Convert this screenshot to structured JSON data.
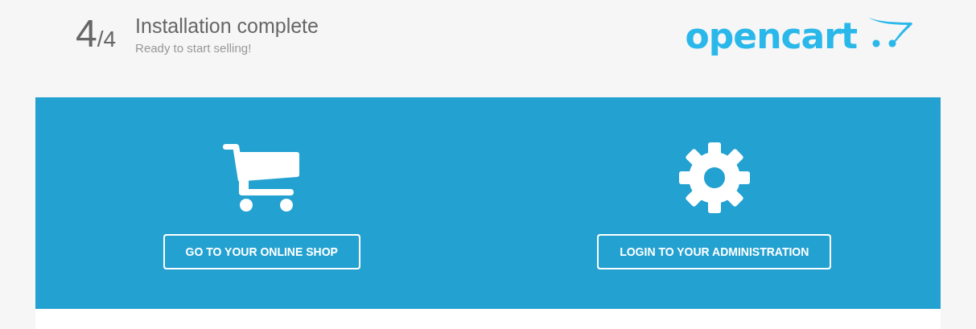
{
  "header": {
    "step_current": "4",
    "step_total": "/4",
    "title": "Installation complete",
    "subtitle": "Ready to start selling!",
    "logo": "opencart"
  },
  "actions": [
    {
      "kind": "shop",
      "label": "GO TO YOUR ONLINE SHOP"
    },
    {
      "kind": "admin",
      "label": "LOGIN TO YOUR ADMINISTRATION"
    }
  ]
}
